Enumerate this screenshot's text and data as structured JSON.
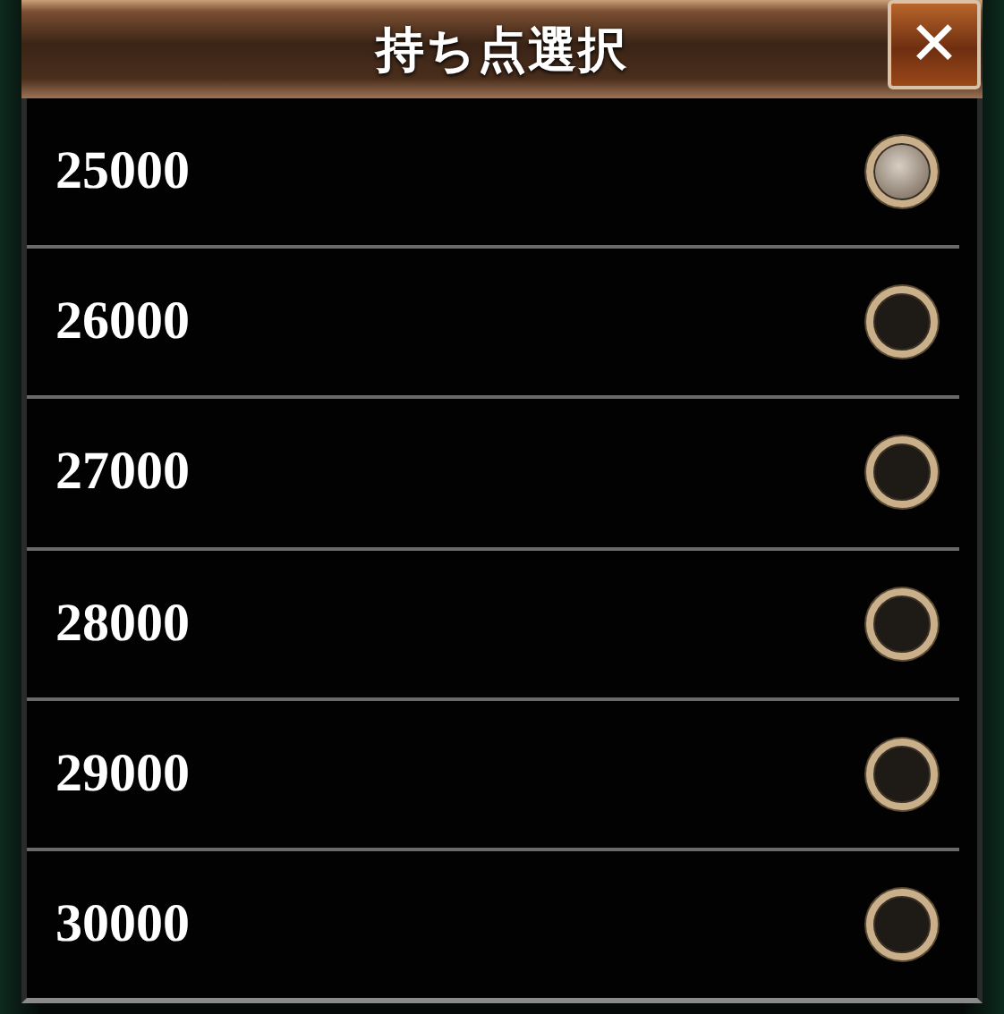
{
  "dialog": {
    "title": "持ち点選択",
    "close_label": "✕"
  },
  "options": [
    {
      "label": "25000",
      "selected": true
    },
    {
      "label": "26000",
      "selected": false
    },
    {
      "label": "27000",
      "selected": false
    },
    {
      "label": "28000",
      "selected": false
    },
    {
      "label": "29000",
      "selected": false
    },
    {
      "label": "30000",
      "selected": false
    }
  ]
}
